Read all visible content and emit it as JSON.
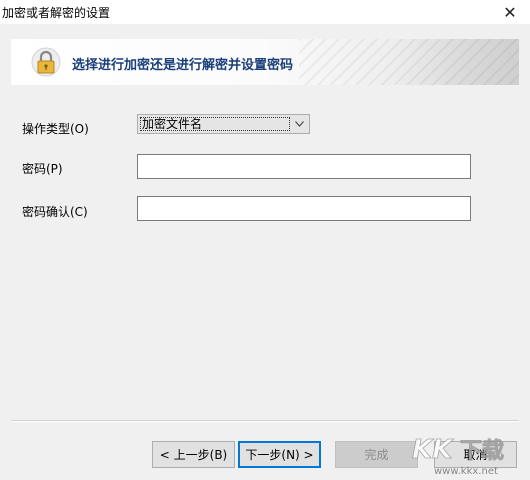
{
  "window": {
    "title": "加密或者解密的设置",
    "close_glyph": "✕"
  },
  "banner": {
    "heading": "选择进行加密还是进行解密并设置密码",
    "icon": "lock-icon"
  },
  "form": {
    "operation_label": "操作类型(O)",
    "operation_value": "加密文件名",
    "password_label": "密码(P)",
    "password_value": "",
    "confirm_label": "密码确认(C)",
    "confirm_value": ""
  },
  "buttons": {
    "back": "< 上一步(B)",
    "next": "下一步(N) >",
    "finish": "完成",
    "cancel": "取消"
  },
  "watermark": {
    "brand": "KK下载",
    "url": "www.kkx.net"
  },
  "colors": {
    "banner_text": "#1a3e7a",
    "accent_border": "#0078d7",
    "lock_yellow": "#e8b73c"
  }
}
